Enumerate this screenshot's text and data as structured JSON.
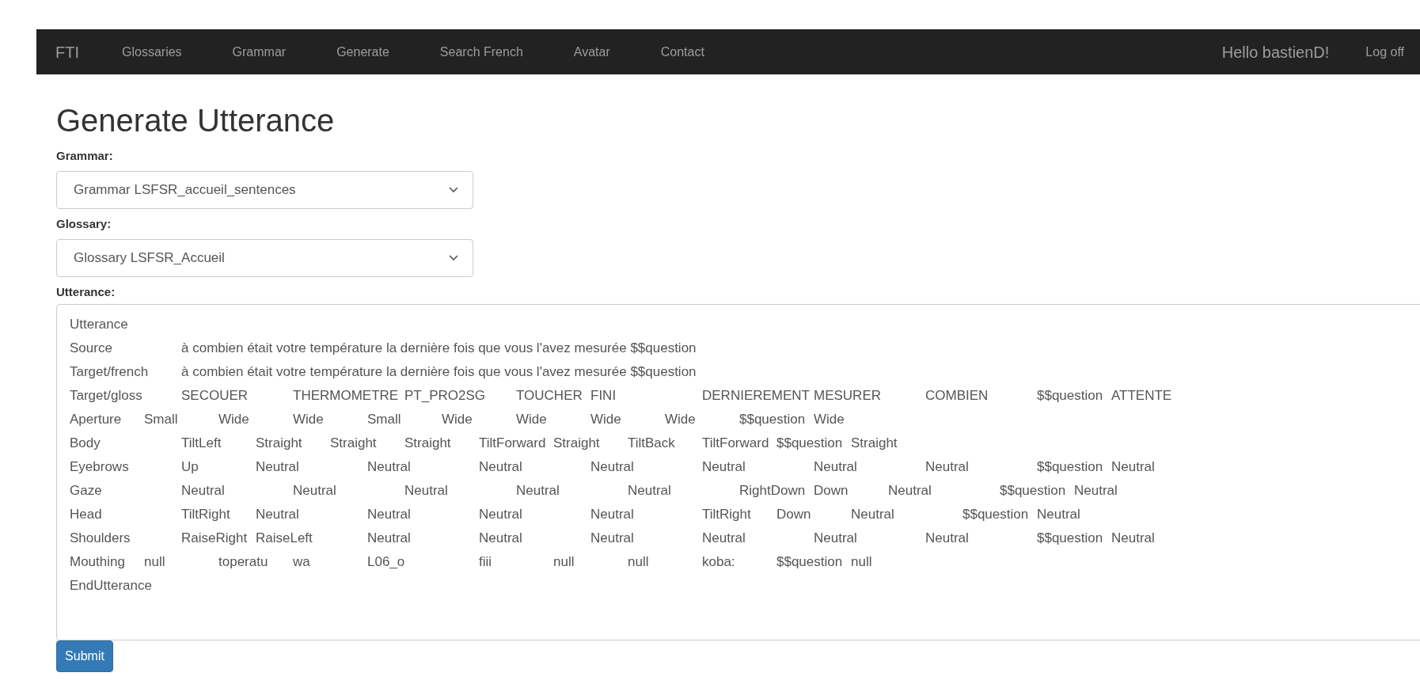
{
  "navbar": {
    "brand": "FTI",
    "links": [
      "Glossaries",
      "Grammar",
      "Generate",
      "Search French",
      "Avatar",
      "Contact"
    ],
    "greeting": "Hello bastienD!",
    "logoff": "Log off"
  },
  "title": "Generate Utterance",
  "fields": [
    {
      "kind": "select",
      "label": "Grammar:",
      "value": "Grammar LSFSR_accueil_sentences"
    },
    {
      "kind": "select",
      "label": "Glossary:",
      "value": "Glossary LSFSR_Accueil"
    },
    {
      "kind": "textarea",
      "label": "Utterance:",
      "lines": [
        "Utterance",
        "Source\t\tà combien était votre température la dernière fois que vous l'avez mesurée $$question",
        "Target/french\tà combien était votre température la dernière fois que vous l'avez mesurée $$question",
        "Target/gloss\tSECOUER\t\tTHERMOMETRE\tPT_PRO2SG\tTOUCHER\tFINI\t\t\tDERNIEREMENT\tMESURER\t\tCOMBIEN\t\t$$question\tATTENTE",
        "Aperture\tSmall\t\tWide\t\tWide\t\tSmall\t\tWide\t\tWide\t\tWide\t\tWide\t\t$$question\tWide",
        "Body\t\t\tTiltLeft\tStraight\tStraight\tStraight\tTiltForward\tStraight\tTiltBack\tTiltForward\t$$question\tStraight",
        "Eyebrows\t\tUp\t\tNeutral\t\tNeutral\t\tNeutral\t\tNeutral\t\tNeutral\t\tNeutral\t\tNeutral\t\t$$question\tNeutral",
        "Gaze\t\t\tNeutral\t\tNeutral\t\tNeutral\t\tNeutral\t\tNeutral\t\tRightDown\tDown\t\tNeutral\t\t$$question\tNeutral",
        "Head\t\t\tTiltRight\tNeutral\t\tNeutral\t\tNeutral\t\tNeutral\t\tTiltRight\tDown\t\tNeutral\t\t$$question\tNeutral",
        "Shoulders\t\tRaiseRight\tRaiseLeft\t\tNeutral\t\tNeutral\t\tNeutral\t\tNeutral\t\tNeutral\t\tNeutral\t\t$$question\tNeutral",
        "Mouthing\tnull\t\ttoperatu\twa\t\tL06_o\t\tfiii\t\tnull\t\tnull\t\tkoba:\t\t$$question\tnull",
        "EndUtterance"
      ]
    }
  ],
  "submit": "Submit"
}
